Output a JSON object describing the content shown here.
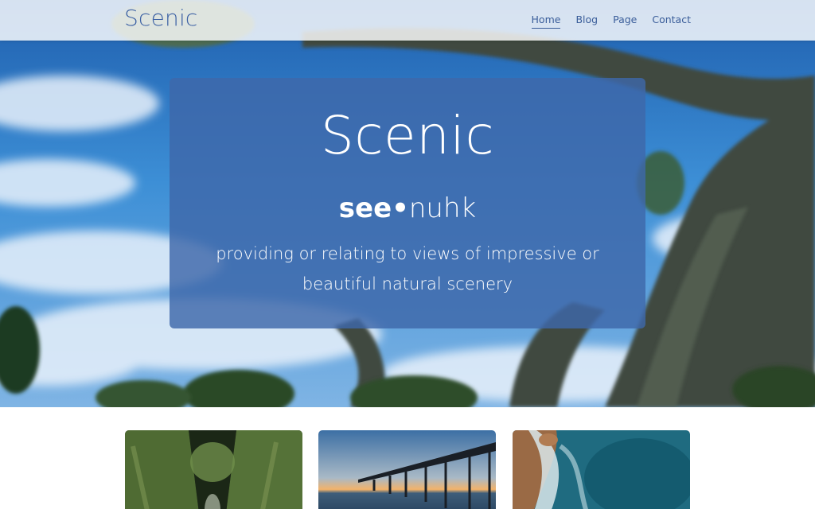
{
  "navbar": {
    "brand": "Scenic",
    "links": [
      {
        "label": "Home",
        "active": true
      },
      {
        "label": "Blog",
        "active": false
      },
      {
        "label": "Page",
        "active": false
      },
      {
        "label": "Contact",
        "active": false
      }
    ]
  },
  "hero": {
    "title": "Scenic",
    "phonetic_first": "see",
    "phonetic_dot": "•",
    "phonetic_second": "nuhk",
    "definition": "providing or relating to views of impressive or beautiful natural scenery"
  },
  "cards": [
    {
      "image": "forest-gorge"
    },
    {
      "image": "pier-sunset"
    },
    {
      "image": "ocean-coast"
    }
  ],
  "colors": {
    "brand": "#3e63a5",
    "card_overlay": "#3e68aa",
    "sky": "#2f7fd0"
  }
}
